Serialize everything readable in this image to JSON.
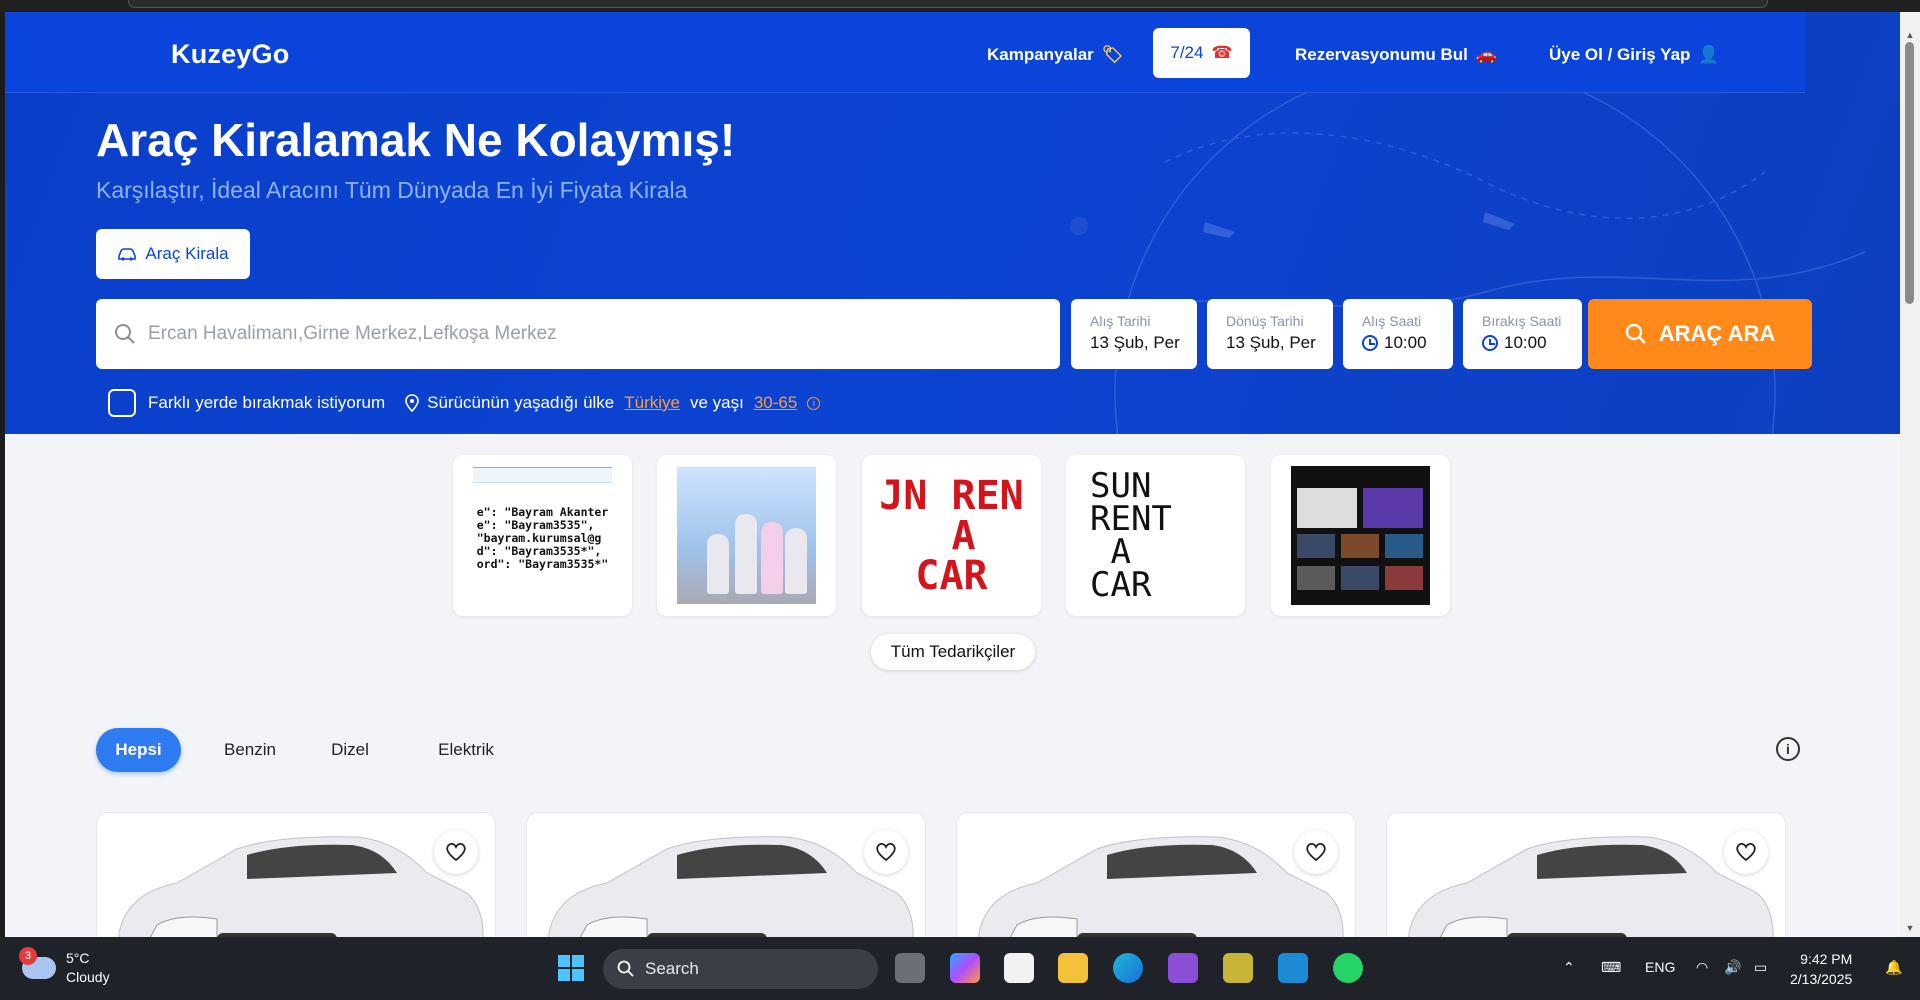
{
  "header": {
    "logo": "KuzeyGo",
    "nav": [
      {
        "label": "Kampanyalar",
        "icon": "tag-icon"
      },
      {
        "label": "7/24",
        "icon": "phone-icon"
      },
      {
        "label": "Rezervasyonumu Bul",
        "icon": "car-icon"
      },
      {
        "label": "Üye Ol / Giriş Yap",
        "icon": "user-icon"
      }
    ]
  },
  "hero": {
    "title": "Araç Kiralamak Ne Kolaymış!",
    "subtitle": "Karşılaştır, İdeal Aracını Tüm Dünyada En İyi Fiyata Kirala",
    "rent_button": "Araç Kirala"
  },
  "search": {
    "placeholder": "Ercan Havalimanı,Girne Merkez,Lefkoşa Merkez",
    "pickup_date": {
      "label": "Alış Tarihi",
      "value": "13 Şub, Per"
    },
    "return_date": {
      "label": "Dönüş Tarihi",
      "value": "13 Şub, Per"
    },
    "pickup_time": {
      "label": "Alış Saati",
      "value": "10:00"
    },
    "dropoff_time": {
      "label": "Bırakış Saati",
      "value": "10:00"
    },
    "button": "ARAÇ ARA",
    "different_dropoff": "Farklı yerde bırakmak istiyorum",
    "driver_country_label": "Sürücünün yaşadığı ülke",
    "driver_country": "Türkiye",
    "age_label": "ve yaşı",
    "age_range": "30-65"
  },
  "suppliers": {
    "code_lines": [
      "e\": \"Bayram Akanter",
      "e\": \"Bayram3535\",",
      " \"bayram.kurumsal@g",
      "d\": \"Bayram3535*\",",
      "ord\": \"Bayram3535*\""
    ],
    "sun_text": "JN REN\n A\nCAR",
    "sun2_text": "SUN\nRENT\n A\nCAR",
    "all_button": "Tüm Tedarikçiler"
  },
  "tabs": [
    "Hepsi",
    "Benzin",
    "Dizel",
    "Elektrik"
  ],
  "taskbar": {
    "temp": "5°C",
    "condition": "Cloudy",
    "weather_badge": "3",
    "search": "Search",
    "lang": "ENG",
    "time": "9:42 PM",
    "date": "2/13/2025"
  },
  "colors": {
    "brand_blue": "#0a44da",
    "accent_orange": "#ff8a1a",
    "tab_active": "#2f7bf2"
  }
}
